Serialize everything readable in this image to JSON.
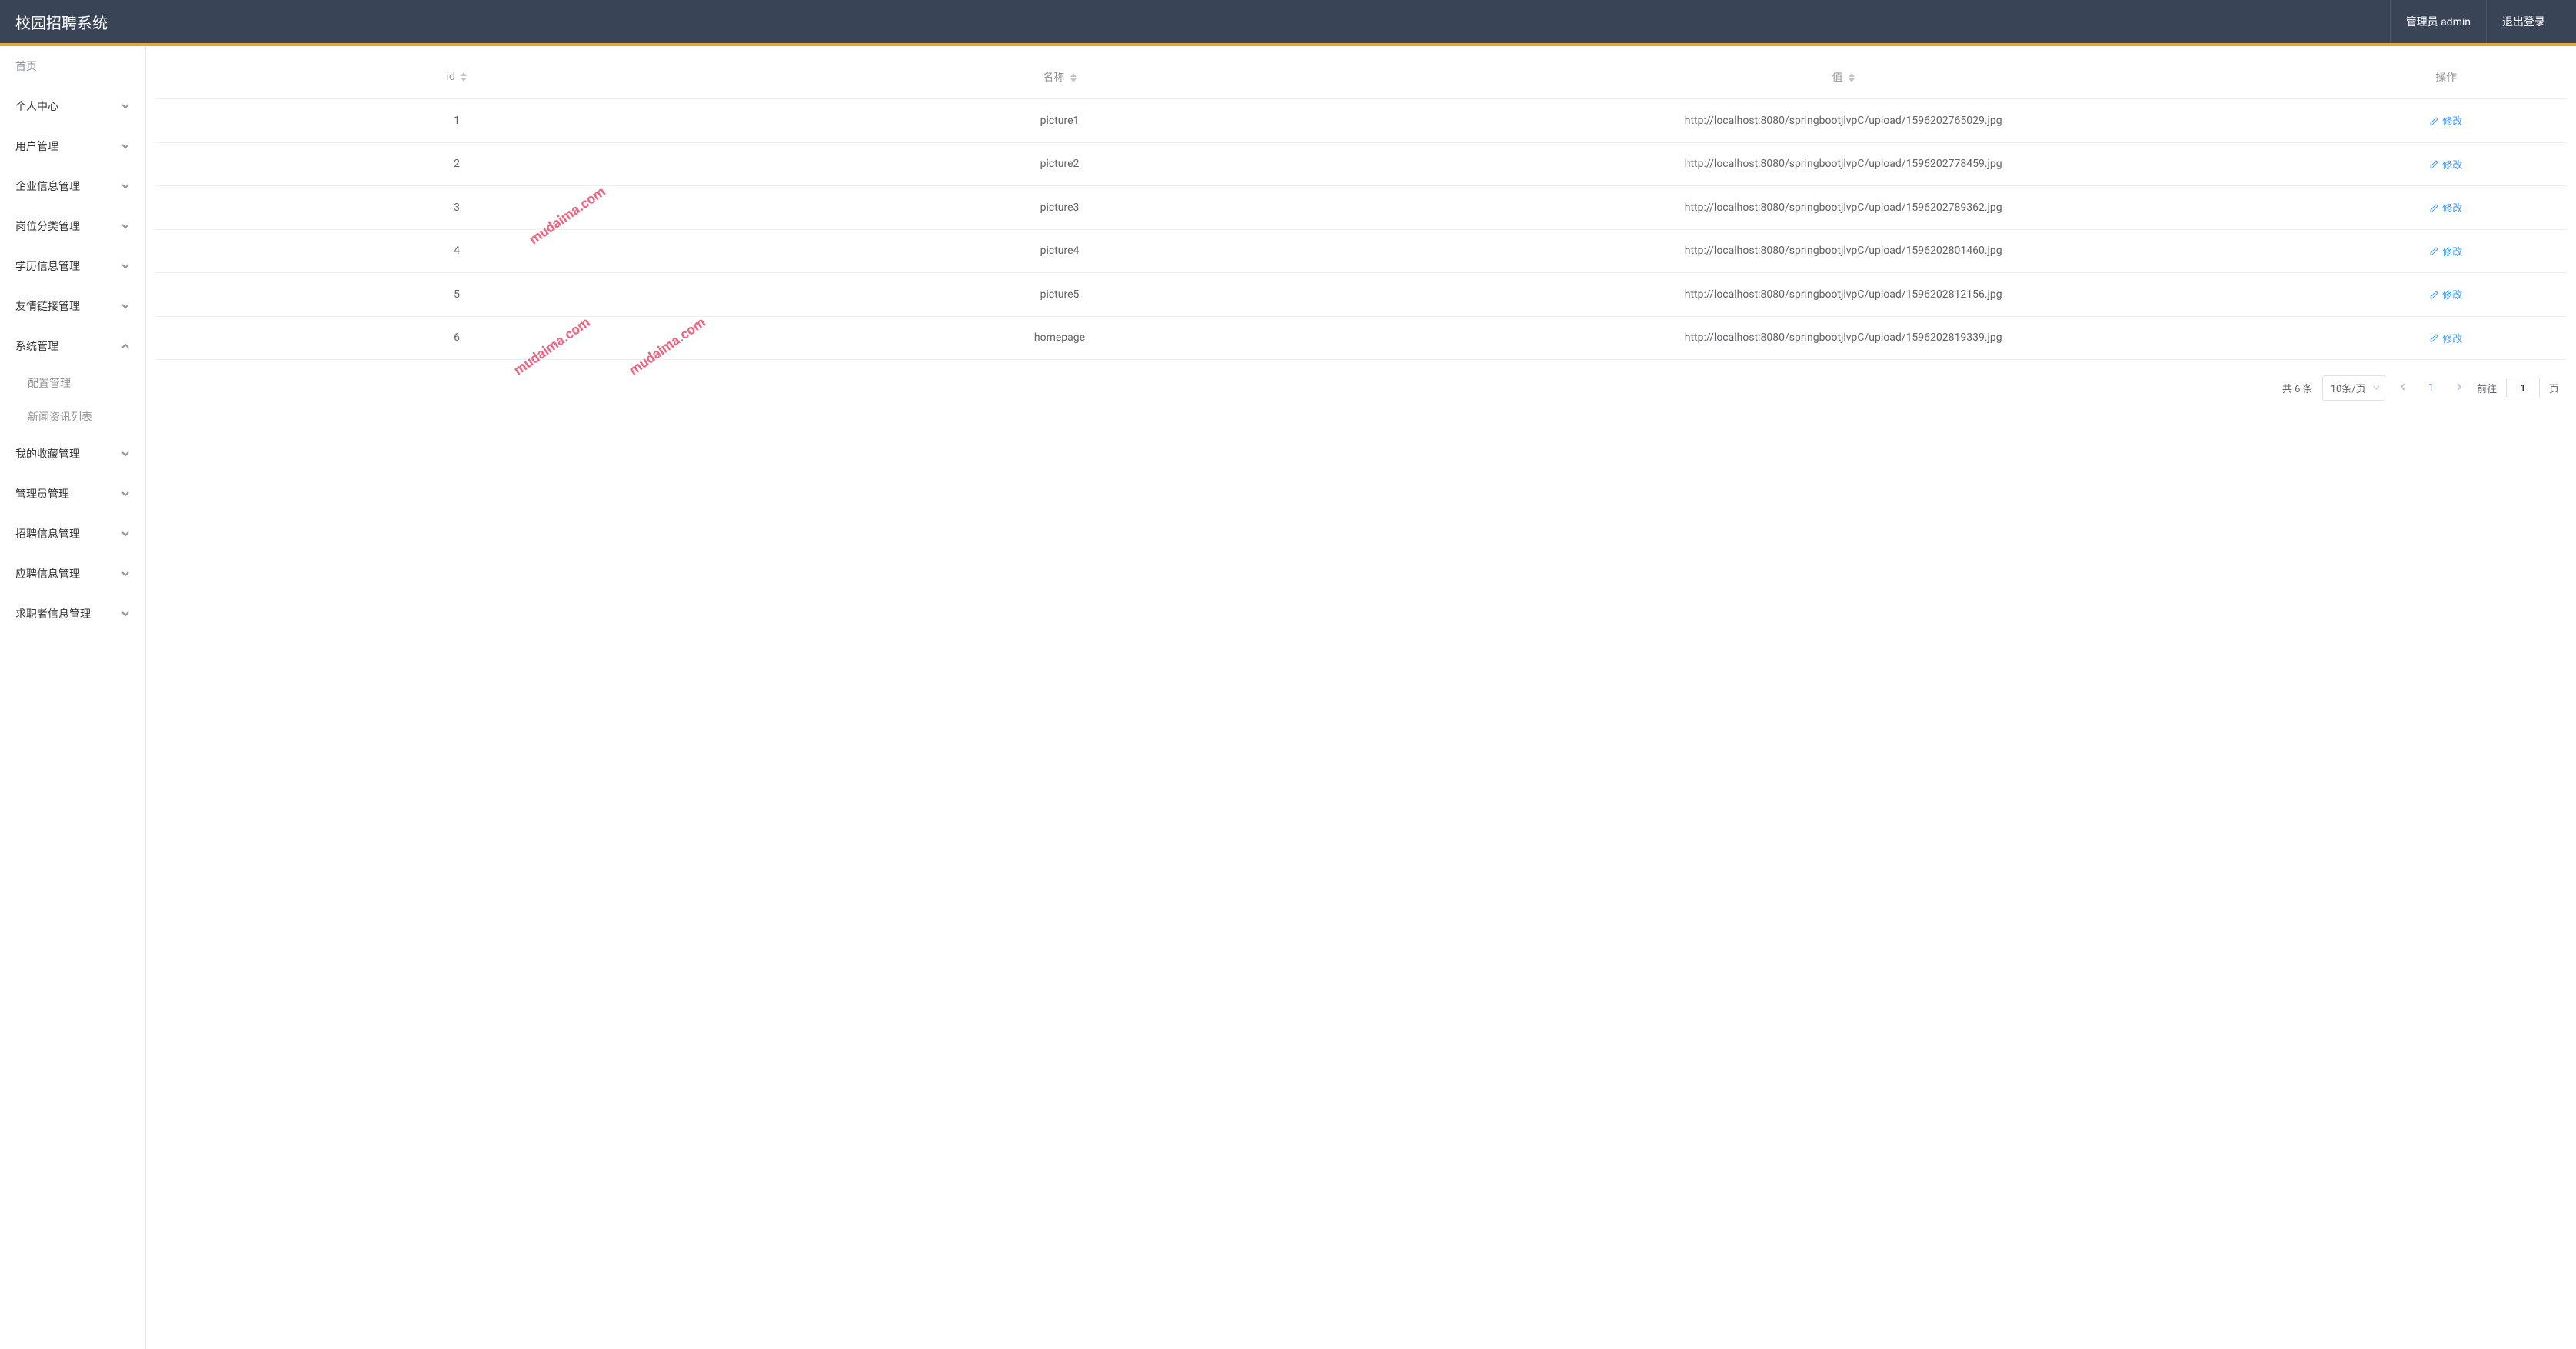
{
  "header": {
    "title": "校园招聘系统",
    "admin_label": "管理员 admin",
    "logout_label": "退出登录"
  },
  "sidebar": {
    "home": "首页",
    "items": [
      {
        "label": "个人中心",
        "expanded": false
      },
      {
        "label": "用户管理",
        "expanded": false
      },
      {
        "label": "企业信息管理",
        "expanded": false
      },
      {
        "label": "岗位分类管理",
        "expanded": false
      },
      {
        "label": "学历信息管理",
        "expanded": false
      },
      {
        "label": "友情链接管理",
        "expanded": false
      },
      {
        "label": "系统管理",
        "expanded": true,
        "children": [
          {
            "label": "配置管理"
          },
          {
            "label": "新闻资讯列表"
          }
        ]
      },
      {
        "label": "我的收藏管理",
        "expanded": false
      },
      {
        "label": "管理员管理",
        "expanded": false
      },
      {
        "label": "招聘信息管理",
        "expanded": false
      },
      {
        "label": "应聘信息管理",
        "expanded": false
      },
      {
        "label": "求职者信息管理",
        "expanded": false
      }
    ]
  },
  "table": {
    "columns": {
      "id": "id",
      "name": "名称",
      "value": "值",
      "action": "操作"
    },
    "action_label": "修改",
    "rows": [
      {
        "id": "1",
        "name": "picture1",
        "value": "http://localhost:8080/springbootjlvpC/upload/1596202765029.jpg"
      },
      {
        "id": "2",
        "name": "picture2",
        "value": "http://localhost:8080/springbootjlvpC/upload/1596202778459.jpg"
      },
      {
        "id": "3",
        "name": "picture3",
        "value": "http://localhost:8080/springbootjlvpC/upload/1596202789362.jpg"
      },
      {
        "id": "4",
        "name": "picture4",
        "value": "http://localhost:8080/springbootjlvpC/upload/1596202801460.jpg"
      },
      {
        "id": "5",
        "name": "picture5",
        "value": "http://localhost:8080/springbootjlvpC/upload/1596202812156.jpg"
      },
      {
        "id": "6",
        "name": "homepage",
        "value": "http://localhost:8080/springbootjlvpC/upload/1596202819339.jpg"
      }
    ]
  },
  "pagination": {
    "total_text": "共 6 条",
    "page_size": "10条/页",
    "current": "1",
    "goto_prefix": "前往",
    "goto_input": "1",
    "goto_suffix": "页"
  },
  "watermark": "mudaima.com"
}
